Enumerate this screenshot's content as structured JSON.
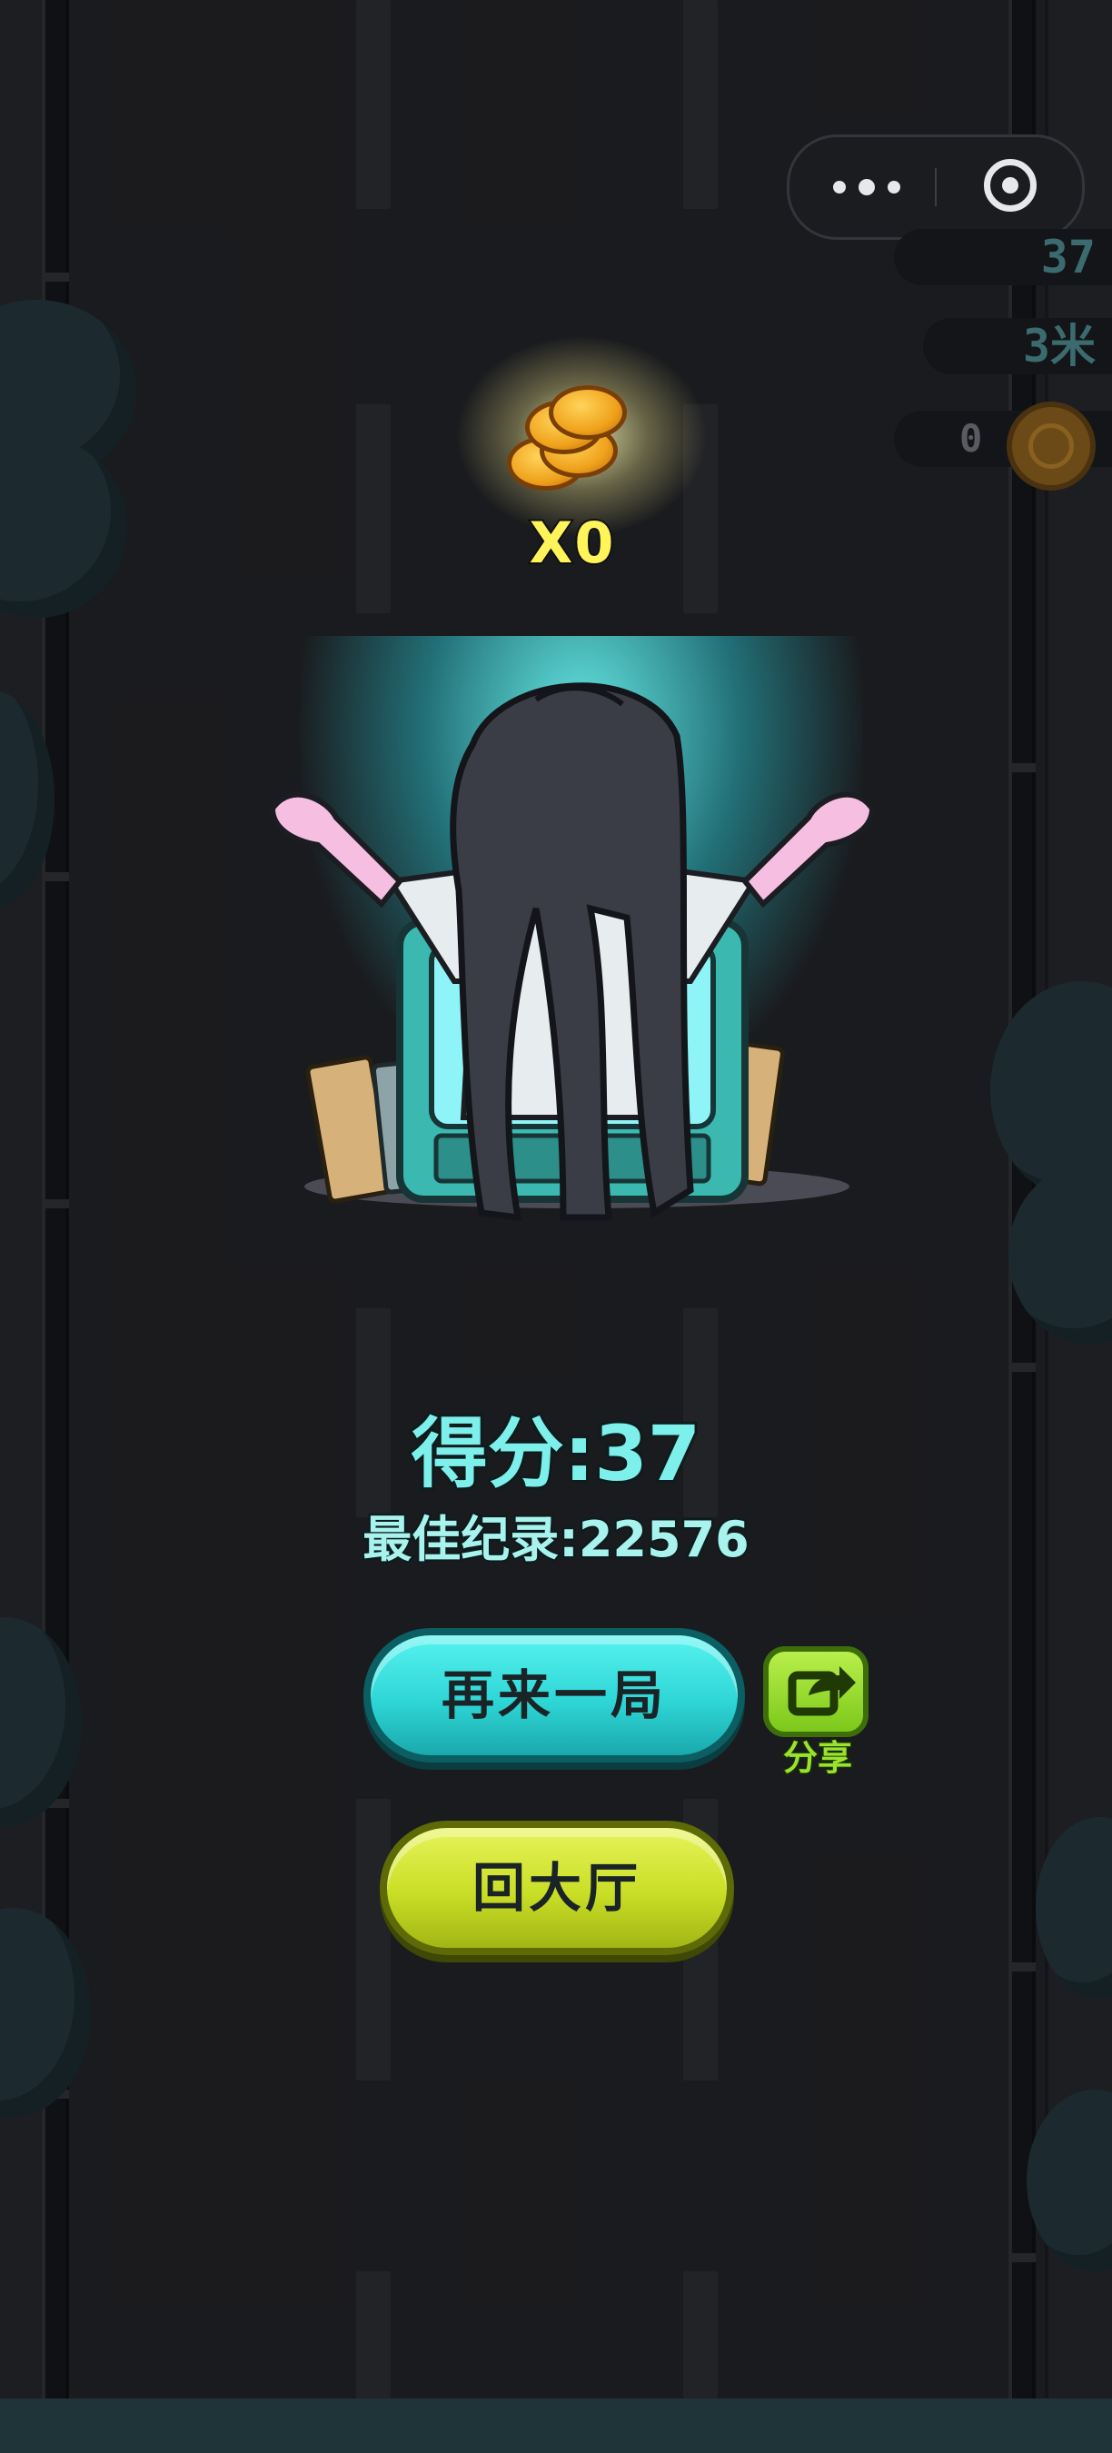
{
  "mini_program_capsule": {
    "more_icon": "more-dots-icon",
    "close_icon": "target-close-icon"
  },
  "hud": {
    "score": "37",
    "distance": "3米",
    "coins": "0"
  },
  "reward": {
    "coin_count_text": "X0"
  },
  "results": {
    "score_text": "得分:37",
    "best_record_text": "最佳纪录:22576"
  },
  "buttons": {
    "play_again": "再来一局",
    "back_to_lobby": "回大厅",
    "share": "分享"
  },
  "colors": {
    "accent_cyan": "#2fd6d6",
    "accent_lime": "#c9de26",
    "share_green": "#7cc81a",
    "score_text": "#7ef0ec",
    "coin_text": "#fff45a"
  }
}
